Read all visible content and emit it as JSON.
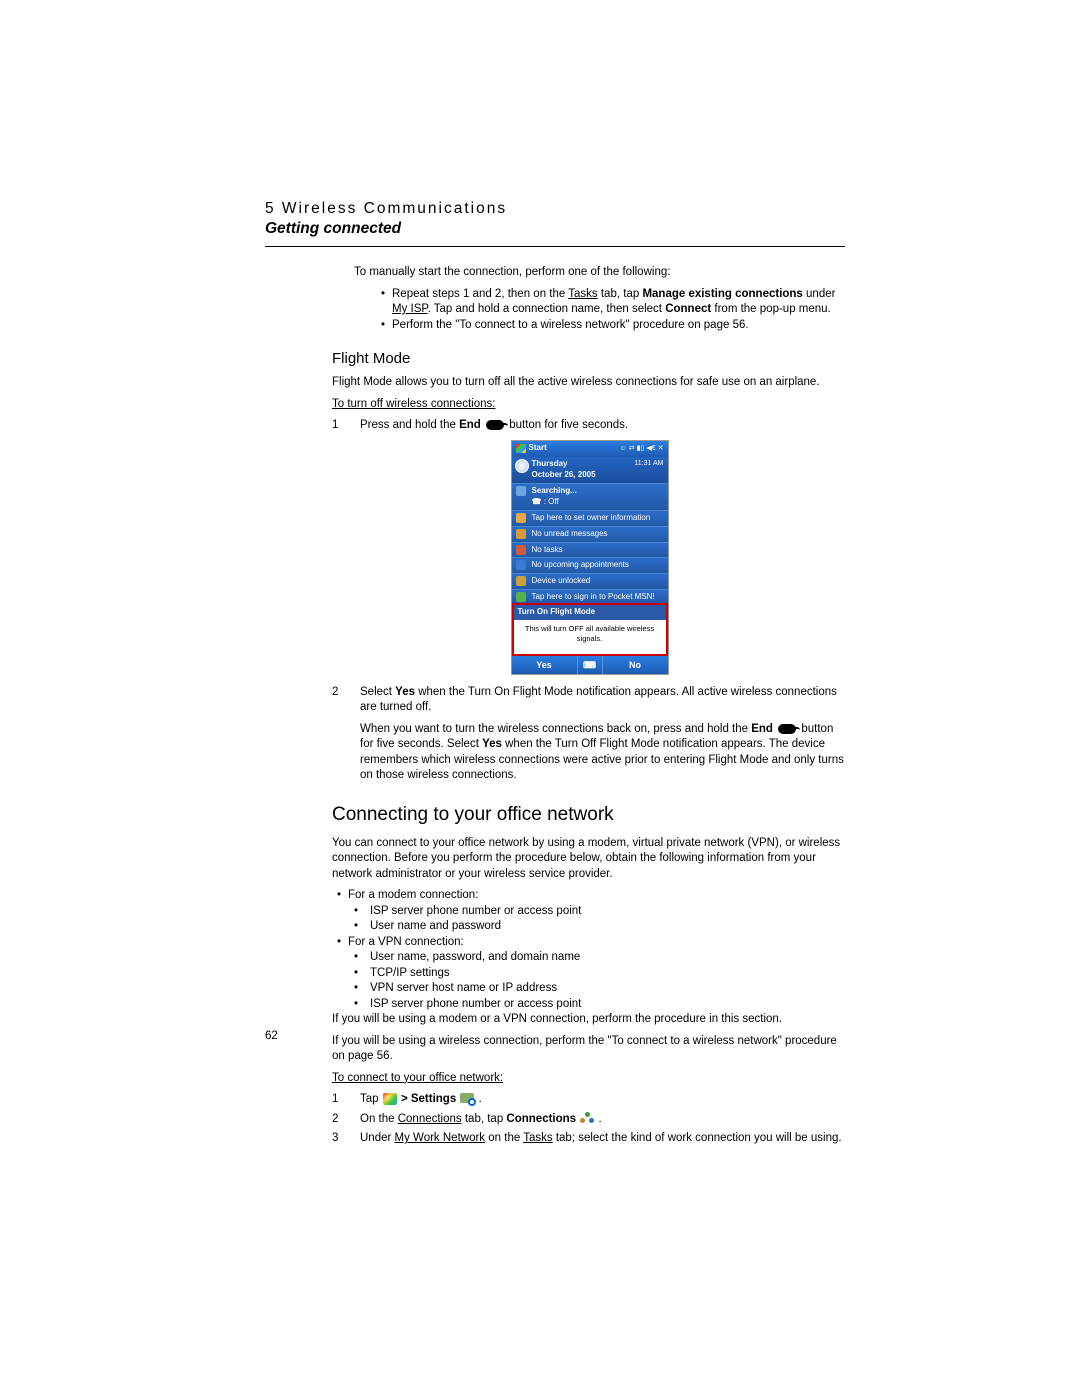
{
  "header": {
    "chapter": "5 Wireless Communications",
    "section": "Getting connected"
  },
  "intro": {
    "lead": "To manually start the connection, perform one of the following:",
    "b1a": "Repeat steps 1 and 2, then on the ",
    "b1b": "Tasks",
    "b1c": " tab, tap ",
    "b1d": "Manage existing connections",
    "b1e": " under ",
    "b1f": "My ISP",
    "b1g": ". Tap and hold a connection name, then select ",
    "b1h": "Connect",
    "b1i": " from the pop-up menu.",
    "b2": "Perform the \"To connect to a wireless network\" procedure on page 56."
  },
  "flight": {
    "title": "Flight Mode",
    "desc": "Flight Mode allows you to turn off all the active wireless connections for safe use on an airplane.",
    "proc": "To turn off wireless connections:",
    "s1a": "Press and hold the ",
    "s1b": "End",
    "s1c": " button for five seconds.",
    "s2a": "Select ",
    "s2b": "Yes",
    "s2c": " when the Turn On Flight Mode notification appears. All active wireless connections are turned off.",
    "s2d": "When you want to turn the wireless connections back on, press and hold the ",
    "s2e": "End",
    "s2f": " button for five seconds. Select ",
    "s2g": "Yes",
    "s2h": " when the Turn Off Flight Mode notification appears. The device remembers which wireless connections were active prior to entering Flight Mode and only turns on those wireless connections."
  },
  "shot": {
    "start": "Start",
    "time": "11:31 AM",
    "day": "Thursday",
    "date": "October 26, 2005",
    "r1a": "Searching...",
    "r1b": "  : Off",
    "r2": "Tap here to set owner information",
    "r3": "No unread messages",
    "r4": "No tasks",
    "r5": "No upcoming appointments",
    "r6": "Device unlocked",
    "r7": "Tap here to sign in to Pocket MSN!",
    "ptitle": "Turn On Flight Mode",
    "pbody": "This will turn OFF all available wireless signals.",
    "yes": "Yes",
    "no": "No"
  },
  "office": {
    "title": "Connecting to your office network",
    "intro": "You can connect to your office network by using a modem, virtual private network (VPN), or wireless connection. Before you perform the procedure below, obtain the following information from your network administrator or your wireless service provider.",
    "m_h": "For a modem connection:",
    "m1": "ISP server phone number or access point",
    "m2": "User name and password",
    "v_h": "For a VPN connection:",
    "v1": "User name, password, and domain name",
    "v2": "TCP/IP settings",
    "v3": "VPN server host name or IP address",
    "v4": "ISP server phone number or access point",
    "after1": "If you will be using a modem or a VPN connection, perform the procedure in this section.",
    "after2": "If you will be using a wireless connection, perform the \"To connect to a wireless network\" procedure on page 56.",
    "proc": "To connect to your office network:",
    "s1a": "Tap ",
    "s1b": " > ",
    "s1c": "Settings",
    "s1d": " .",
    "s2a": "On the ",
    "s2b": "Connections",
    "s2c": " tab, tap ",
    "s2d": "Connections",
    "s2e": " .",
    "s3a": "Under ",
    "s3b": "My Work Network",
    "s3c": " on the ",
    "s3d": "Tasks",
    "s3e": " tab; select the kind of work connection you will be using."
  },
  "pagenum": "62"
}
